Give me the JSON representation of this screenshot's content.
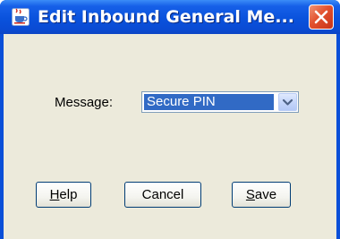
{
  "window": {
    "title": "Edit Inbound General Me...",
    "app_icon": "java-coffee-cup-icon",
    "close_icon": "close-icon",
    "colors": {
      "titlebar": "#0a52dc",
      "close_button": "#e2512e",
      "client_background": "#eceadb",
      "selection": "#316ac5"
    }
  },
  "form": {
    "message_label": "Message:",
    "message_value": "Secure PIN",
    "dropdown_icon": "chevron-down-icon"
  },
  "buttons": {
    "help": "Help",
    "cancel": "Cancel",
    "save": "Save"
  }
}
